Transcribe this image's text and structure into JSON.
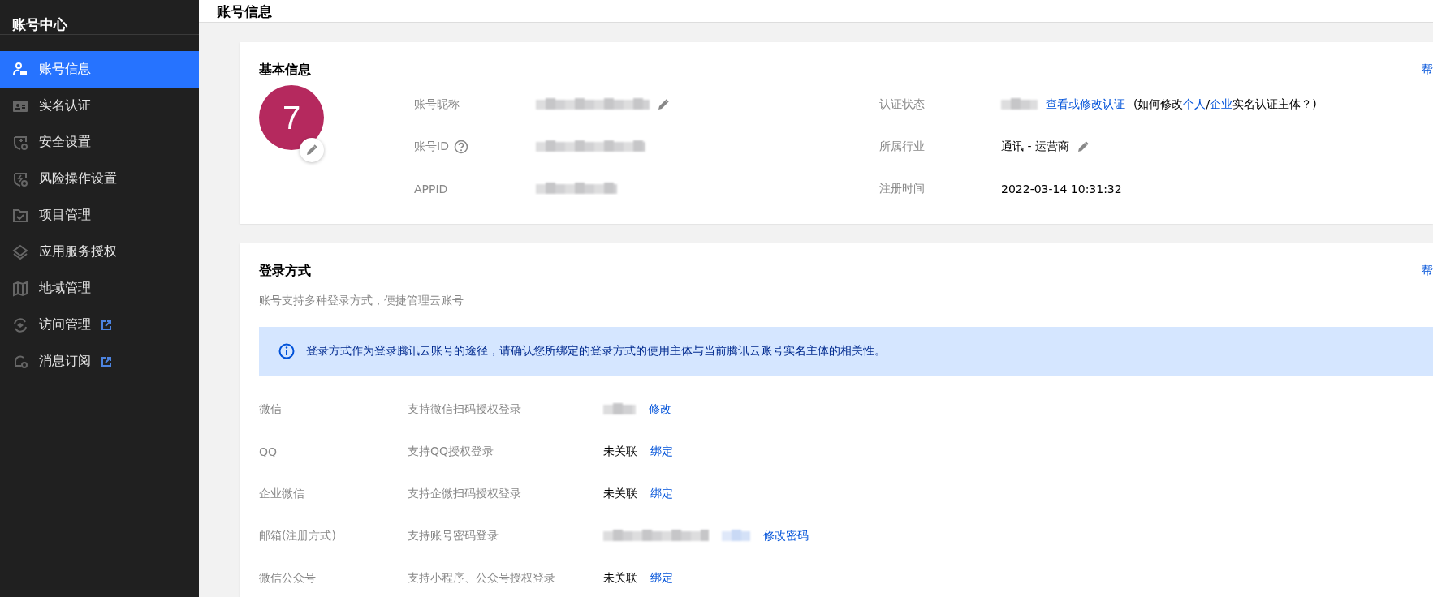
{
  "sidebar": {
    "title": "账号中心",
    "items": [
      {
        "label": "账号信息",
        "selected": true,
        "external": false
      },
      {
        "label": "实名认证",
        "selected": false,
        "external": false
      },
      {
        "label": "安全设置",
        "selected": false,
        "external": false
      },
      {
        "label": "风险操作设置",
        "selected": false,
        "external": false
      },
      {
        "label": "项目管理",
        "selected": false,
        "external": false
      },
      {
        "label": "应用服务授权",
        "selected": false,
        "external": false
      },
      {
        "label": "地域管理",
        "selected": false,
        "external": false
      },
      {
        "label": "访问管理",
        "selected": false,
        "external": true
      },
      {
        "label": "消息订阅",
        "selected": false,
        "external": true
      }
    ]
  },
  "header": {
    "title": "账号信息"
  },
  "basic_info": {
    "title": "基本信息",
    "help_link": "帮",
    "avatar": {
      "initial": "7",
      "color": "#b5295e"
    },
    "fields": [
      {
        "label": "账号昵称",
        "kind": "redacted",
        "editable": true,
        "help": false
      },
      {
        "label": "账号ID",
        "kind": "redacted",
        "editable": false,
        "help": true
      },
      {
        "label": "APPID",
        "kind": "redacted",
        "editable": false,
        "help": false
      },
      {
        "label": "认证状态",
        "kind": "redacted",
        "editable": false,
        "help": false,
        "link": "查看或修改认证",
        "note": [
          {
            "kind": "text",
            "text": "(如何修改"
          },
          {
            "kind": "link",
            "text": "个人"
          },
          {
            "kind": "text",
            "text": "/"
          },
          {
            "kind": "link",
            "text": "企业"
          },
          {
            "kind": "text",
            "text": "实名认证主体？)"
          }
        ]
      },
      {
        "label": "所属行业",
        "kind": "text",
        "value": "通讯 - 运营商",
        "editable": true,
        "help": false
      },
      {
        "label": "注册时间",
        "kind": "text",
        "value": "2022-03-14 10:31:32",
        "editable": false,
        "help": false
      }
    ]
  },
  "login_methods": {
    "title": "登录方式",
    "help_link": "帮",
    "subtitle": "账号支持多种登录方式，便捷管理云账号",
    "notice": "登录方式作为登录腾讯云账号的途径，请确认您所绑定的登录方式的使用主体与当前腾讯云账号实名主体的相关性。",
    "rows": [
      {
        "name": "微信",
        "description": "支持微信扫码授权登录",
        "kind": "redacted",
        "action": "修改"
      },
      {
        "name": "QQ",
        "description": "支持QQ授权登录",
        "kind": "text",
        "value": "未关联",
        "action": "绑定"
      },
      {
        "name": "企业微信",
        "description": "支持企微扫码授权登录",
        "kind": "text",
        "value": "未关联",
        "action": "绑定"
      },
      {
        "name": "邮箱(注册方式)",
        "description": "支持账号密码登录",
        "kind": "redacted",
        "action": "修改密码"
      },
      {
        "name": "微信公众号",
        "description": "支持小程序、公众号授权登录",
        "kind": "text",
        "value": "未关联",
        "action": "绑定"
      }
    ]
  }
}
